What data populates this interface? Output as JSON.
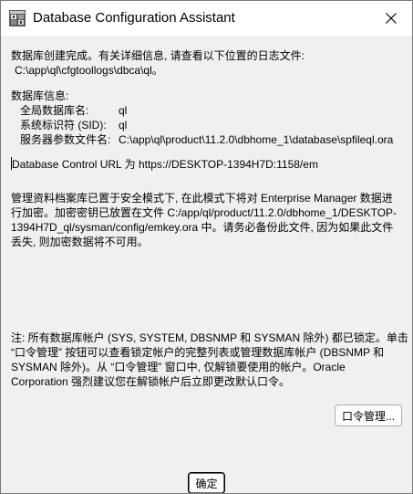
{
  "window": {
    "title": "Database Configuration Assistant",
    "app_icon": "dbca-app-icon",
    "close_icon": "close-icon"
  },
  "message": {
    "complete_line": "数据库创建完成。有关详细信息, 请查看以下位置的日志文件:",
    "log_path": "C:\\app\\ql\\cfgtoollogs\\dbca\\ql。",
    "db_info_header": "数据库信息:",
    "db_info": [
      {
        "label": "全局数据库名:",
        "value": "ql"
      },
      {
        "label": "系统标识符 (SID):",
        "value": "ql"
      },
      {
        "label": "服务器参数文件名:",
        "value": "C:\\app\\ql\\product\\11.2.0\\dbhome_1\\database\\spfileql.ora"
      }
    ],
    "em_url_line": "Database Control URL 为 https://DESKTOP-1394H7D:1158/em",
    "repo_lines": [
      "管理资料档案库已置于安全模式下, 在此模式下将对 Enterprise Manager 数据进",
      "行加密。加密密钥已放置在文件 C:/app/ql/product/11.2.0/dbhome_1/DESKTOP-",
      "1394H7D_ql/sysman/config/emkey.ora 中。请务必备份此文件, 因为如果此文件",
      "丢失, 则加密数据将不可用。"
    ],
    "note_lines": [
      "注: 所有数据库帐户 (SYS, SYSTEM, DBSNMP 和 SYSMAN 除外) 都已锁定。单击",
      "“口令管理” 按钮可以查看锁定帐户的完整列表或管理数据库帐户 (DBSNMP 和",
      "SYSMAN 除外)。从 “口令管理” 窗口中, 仅解锁要使用的帐户。Oracle",
      "Corporation 强烈建议您在解锁帐户后立即更改默认口令。"
    ]
  },
  "buttons": {
    "password_management": "口令管理...",
    "ok": "确定"
  }
}
